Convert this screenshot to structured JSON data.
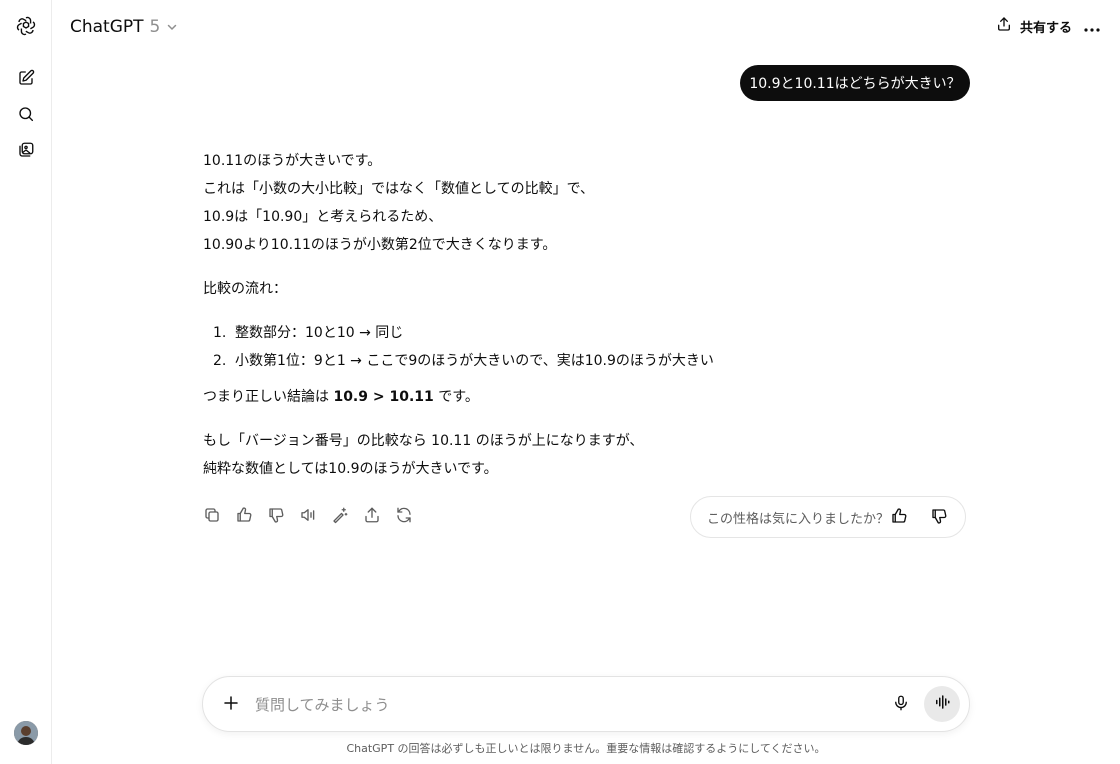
{
  "header": {
    "model_name": "ChatGPT",
    "model_version": "5",
    "share_label": "共有する"
  },
  "sidebar": {
    "items": [
      {
        "icon": "new-chat-icon"
      },
      {
        "icon": "search-icon"
      },
      {
        "icon": "library-icon"
      }
    ]
  },
  "conversation": {
    "user_message": "10.9と10.11はどちらが大きい？",
    "answer": {
      "p1": [
        "10.11のほうが大きいです。",
        "これは「小数の大小比較」ではなく「数値としての比較」で、",
        "10.9は「10.90」と考えられるため、",
        "10.90より10.11のほうが小数第2位で大きくなります。"
      ],
      "flow_heading": "比較の流れ：",
      "list": [
        {
          "num": "1.",
          "text": "整数部分：10と10 → 同じ"
        },
        {
          "num": "2.",
          "text": "小数第1位：9と1 → ここで9のほうが大きいので、実は10.9のほうが大きい"
        }
      ],
      "conclusion_prefix": "つまり正しい結論は ",
      "conclusion_bold": "10.9 > 10.11",
      "conclusion_suffix": " です。",
      "p3": [
        "もし「バージョン番号」の比較なら 10.11 のほうが上になりますが、",
        "純粋な数値としては10.9のほうが大きいです。"
      ]
    },
    "feedback_question": "この性格は気に入りましたか？"
  },
  "composer": {
    "placeholder": "質問してみましょう"
  },
  "footer": {
    "disclaimer": "ChatGPT の回答は必ずしも正しいとは限りません。重要な情報は確認するようにしてください。"
  }
}
